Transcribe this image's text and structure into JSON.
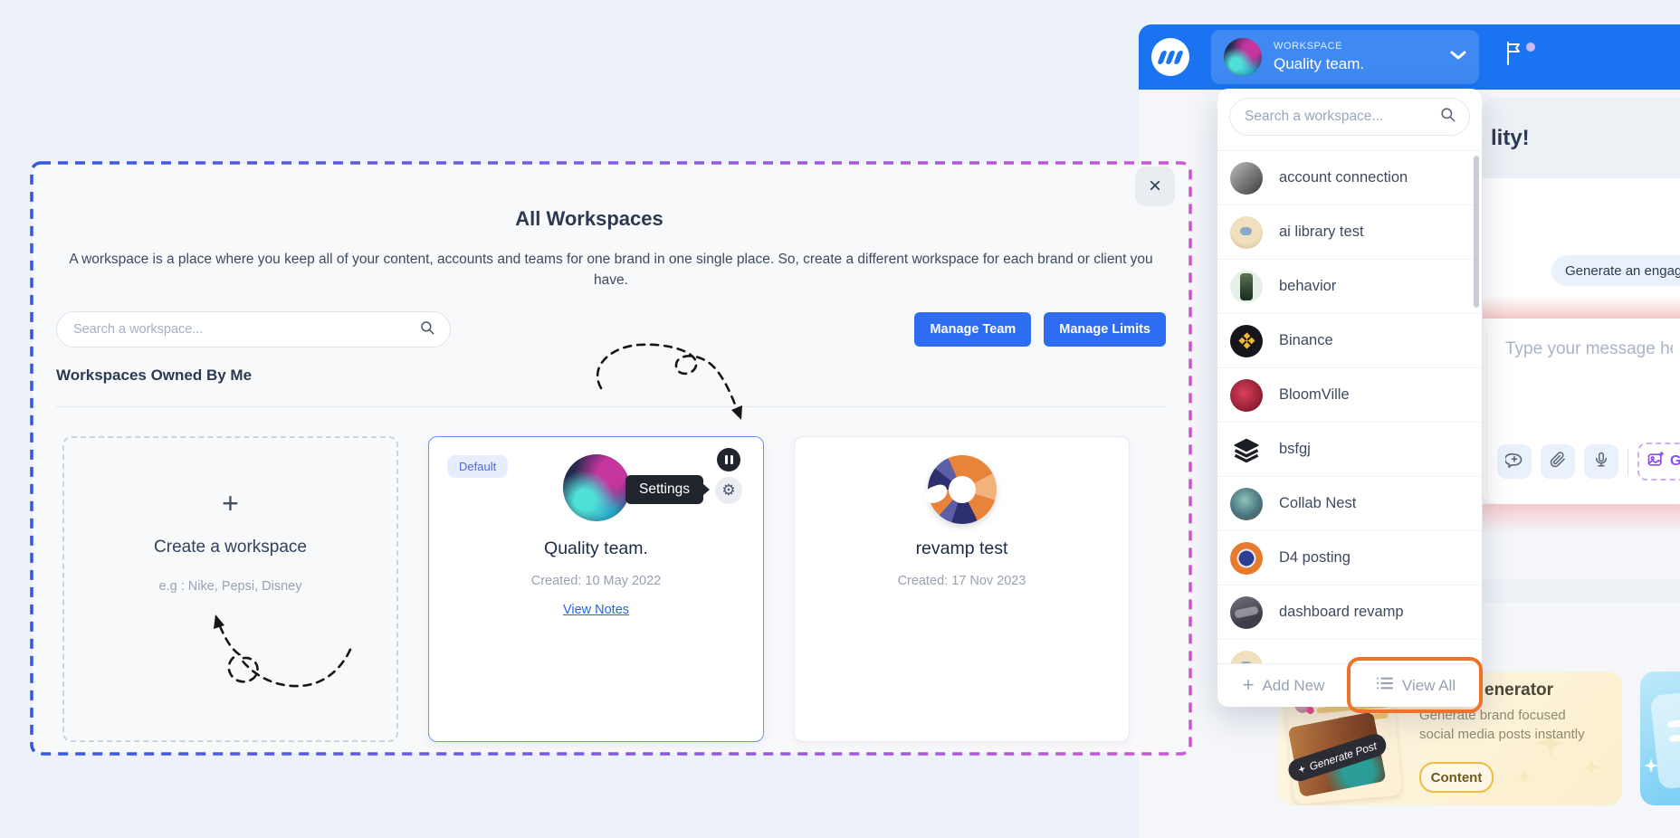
{
  "colors": {
    "accent_blue": "#1a73f0",
    "button_blue": "#2e6cf2",
    "highlight_orange": "#f0712b",
    "link_blue": "#2166e8"
  },
  "header": {
    "workspace_label": "WORKSPACE",
    "workspace_name": "Quality team."
  },
  "workspace_dropdown": {
    "search_placeholder": "Search a workspace...",
    "items": [
      {
        "name": "account connection"
      },
      {
        "name": "ai library test"
      },
      {
        "name": "behavior"
      },
      {
        "name": "Binance"
      },
      {
        "name": "BloomVille"
      },
      {
        "name": "bsfgj"
      },
      {
        "name": "Collab Nest"
      },
      {
        "name": "D4 posting"
      },
      {
        "name": "dashboard revamp"
      },
      {
        "name": ""
      }
    ],
    "add_new_label": "Add New",
    "view_all_label": "View All"
  },
  "modal": {
    "title": "All Workspaces",
    "description": "A workspace is a place where you keep all of your content, accounts and teams for one brand in one single place. So, create a different workspace for each brand or client you have.",
    "search_placeholder": "Search a workspace...",
    "manage_team_label": "Manage Team",
    "manage_limits_label": "Manage Limits",
    "section_title": "Workspaces Owned By Me",
    "create_card": {
      "title": "Create a workspace",
      "hint": "e.g : Nike, Pepsi, Disney"
    },
    "default_card": {
      "badge": "Default",
      "name": "Quality team.",
      "created": "Created: 10 May 2022",
      "link": "View Notes",
      "tooltip": "Settings"
    },
    "revamp_card": {
      "name": "revamp test",
      "created": "Created: 17 Nov 2023"
    }
  },
  "chat": {
    "heading_partial": "lity!",
    "suggestion_chip": "Generate an engag",
    "input_placeholder": "Type your message here...",
    "generate_button_partial": "G"
  },
  "promo": {
    "title_partial": "enerator",
    "description": "Generate brand focused social media posts instantly",
    "tag": "Content",
    "mockup_button": "Generate Post"
  },
  "glyphs": {
    "plus": "+",
    "close": "×",
    "gear": "⚙"
  }
}
